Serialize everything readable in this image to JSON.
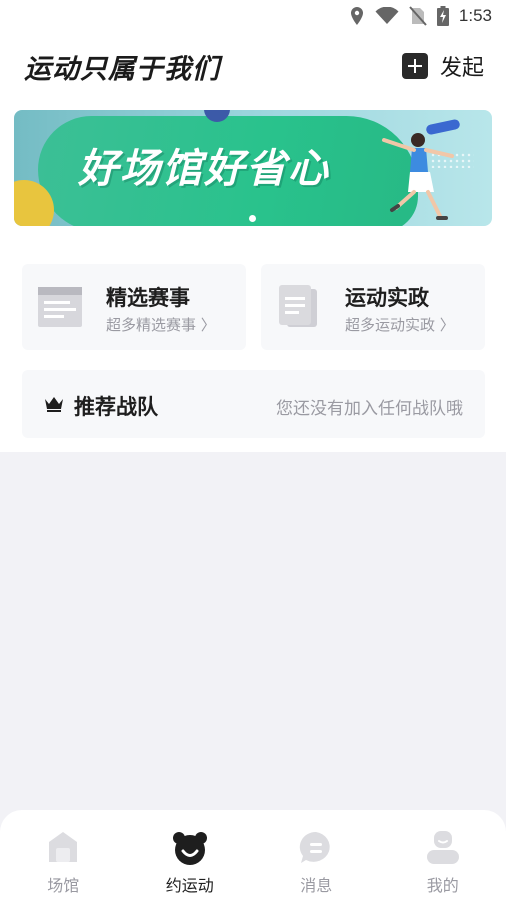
{
  "status_bar": {
    "time": "1:53",
    "icons": [
      "location-icon",
      "wifi-icon",
      "no-sim-icon",
      "battery-charging-icon"
    ]
  },
  "header": {
    "title": "运动只属于我们",
    "launch_label": "发起",
    "launch_icon": "plus-square-icon"
  },
  "banner": {
    "headline": "好场馆好省心",
    "page_indicator": {
      "current": 1,
      "total": 1
    }
  },
  "cards": [
    {
      "title": "精选赛事",
      "subtitle": "超多精选赛事 〉",
      "icon": "news-icon"
    },
    {
      "title": "运动实政",
      "subtitle": "超多运动实政 〉",
      "icon": "document-icon"
    }
  ],
  "team": {
    "title": "推荐战队",
    "empty_text": "您还没有加入任何战队哦",
    "icon": "crown-icon"
  },
  "bottom_nav": [
    {
      "label": "场馆",
      "icon": "venue-icon",
      "active": false
    },
    {
      "label": "约运动",
      "icon": "bear-icon",
      "active": true
    },
    {
      "label": "消息",
      "icon": "message-icon",
      "active": false
    },
    {
      "label": "我的",
      "icon": "profile-icon",
      "active": false
    }
  ],
  "colors": {
    "accent_dark": "#1e1e1e",
    "muted_text": "#9a9aa2",
    "banner_green": "#29c28c",
    "page_bg": "#f2f2f6"
  }
}
